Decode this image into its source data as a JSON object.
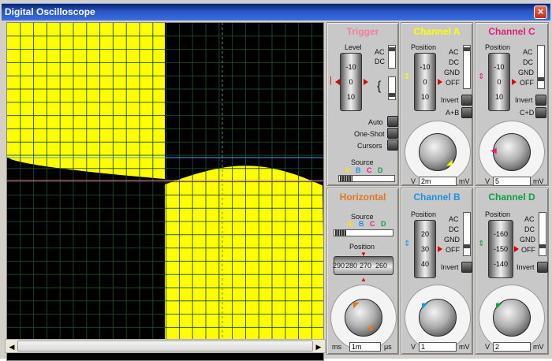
{
  "window": {
    "title": "Digital Oscilloscope",
    "close_icon": "close-icon"
  },
  "trigger": {
    "title": "Trigger",
    "level_label": "Level",
    "ac": "AC",
    "dc": "DC",
    "ticks": [
      "-10",
      "0",
      "10"
    ],
    "auto": "Auto",
    "one_shot": "One-Shot",
    "cursors": "Cursors",
    "source_label": "Source",
    "sources": [
      "A",
      "B",
      "C",
      "D"
    ],
    "color": "#f080a0"
  },
  "channel_a": {
    "title": "Channel A",
    "position_label": "Position",
    "ac": "AC",
    "dc": "DC",
    "gnd": "GND",
    "off": "OFF",
    "invert": "Invert",
    "combine": "A+B",
    "ticks": [
      "-10",
      "0",
      "10"
    ],
    "dial_left": "V",
    "dial_right": "mV",
    "value": "2m",
    "color": "#ffff00"
  },
  "channel_c": {
    "title": "Channel C",
    "position_label": "Position",
    "ac": "AC",
    "dc": "DC",
    "gnd": "GND",
    "off": "OFF",
    "invert": "Invert",
    "combine": "C+D",
    "ticks": [
      "-10",
      "0",
      "10"
    ],
    "dial_left": "V",
    "dial_right": "mV",
    "value": "5",
    "color": "#e0207a"
  },
  "horizontal": {
    "title": "Horizontal",
    "source_label": "Source",
    "sources": [
      "A",
      "B",
      "C",
      "D"
    ],
    "position_label": "Position",
    "ticks": [
      "290",
      "280",
      "270",
      "260"
    ],
    "dial_left": "ms",
    "dial_right": "μs",
    "value": "1m",
    "color": "#e07820"
  },
  "channel_b": {
    "title": "Channel B",
    "position_label": "Position",
    "ac": "AC",
    "dc": "DC",
    "gnd": "GND",
    "off": "OFF",
    "invert": "Invert",
    "ticks": [
      "20",
      "30",
      "40"
    ],
    "dial_left": "V",
    "dial_right": "mV",
    "value": "1",
    "color": "#2090e0"
  },
  "channel_d": {
    "title": "Channel D",
    "position_label": "Position",
    "ac": "AC",
    "dc": "DC",
    "gnd": "GND",
    "off": "OFF",
    "invert": "Invert",
    "ticks": [
      "-160",
      "-150",
      "-140"
    ],
    "dial_left": "V",
    "dial_right": "mV",
    "value": "2",
    "color": "#10a040"
  },
  "dial_scale_v": [
    "0.5",
    "0.2",
    "0.1",
    "50",
    "20",
    "10",
    "5",
    "2",
    "1",
    "10",
    "20"
  ],
  "dial_scale_t": [
    "0.5",
    "0.2",
    "0.1",
    "50",
    "20",
    "10",
    "5",
    "2",
    "1",
    "0.5",
    "0.2",
    "0.1",
    "50",
    "20",
    "10",
    "5",
    "2",
    "1",
    "200",
    "100"
  ]
}
